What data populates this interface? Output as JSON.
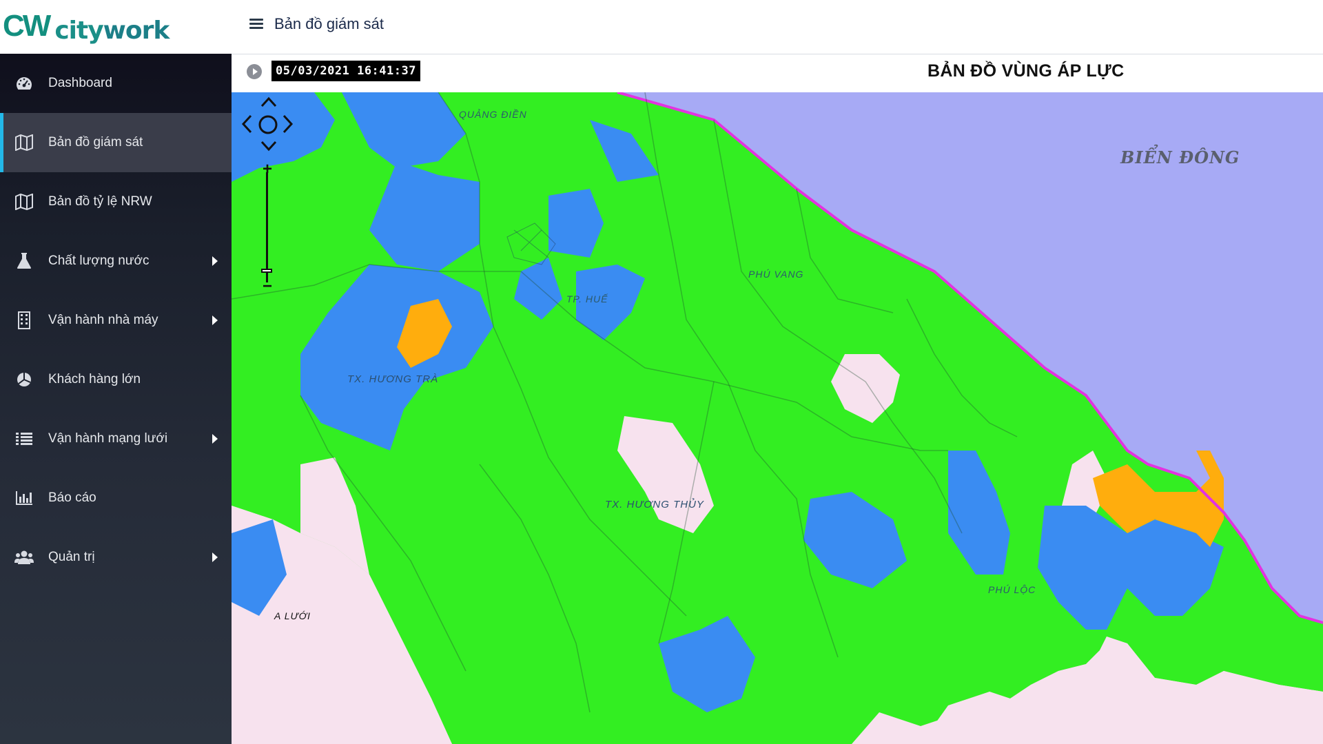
{
  "brand": {
    "mark": "CW",
    "name_city": "city",
    "name_work": "work"
  },
  "header": {
    "page_title": "Bản đồ giám sát"
  },
  "sidebar": {
    "items": [
      {
        "label": "Dashboard",
        "icon": "dashboard-icon",
        "has_submenu": false
      },
      {
        "label": "Bản đồ giám sát",
        "icon": "map-icon",
        "has_submenu": false,
        "active": true
      },
      {
        "label": "Bản đồ tỷ lệ NRW",
        "icon": "map-icon",
        "has_submenu": false
      },
      {
        "label": "Chất lượng nước",
        "icon": "flask-icon",
        "has_submenu": true
      },
      {
        "label": "Vận hành nhà máy",
        "icon": "building-icon",
        "has_submenu": true
      },
      {
        "label": "Khách hàng lớn",
        "icon": "pie-icon",
        "has_submenu": false
      },
      {
        "label": "Vận hành mạng lưới",
        "icon": "list-icon",
        "has_submenu": true
      },
      {
        "label": "Báo cáo",
        "icon": "bar-chart-icon",
        "has_submenu": false
      },
      {
        "label": "Quản trị",
        "icon": "users-icon",
        "has_submenu": true
      }
    ]
  },
  "map": {
    "timestamp": "05/03/2021 16:41:37",
    "title": "BẢN ĐỒ VÙNG ÁP LỰC",
    "sea_label": "BIỂN ĐÔNG",
    "places": {
      "quang_dien": "QUẢNG ĐIỀN",
      "phu_vang": "PHÚ VANG",
      "tp_hue": "TP. HUẾ",
      "huong_tra": "TX. HƯƠNG TRÀ",
      "huong_thuy": "TX. HƯƠNG THỦY",
      "phu_loc": "PHÚ LỘC",
      "a_luoi": "A LƯỚI"
    },
    "colors": {
      "high_pressure": "#33ee22",
      "normal_pressure": "#3a8cf2",
      "low_pressure": "#ffad0d",
      "no_data": "#f7e2ee",
      "sea": "#a7aaf5",
      "coast_line": "#e233e0"
    }
  }
}
